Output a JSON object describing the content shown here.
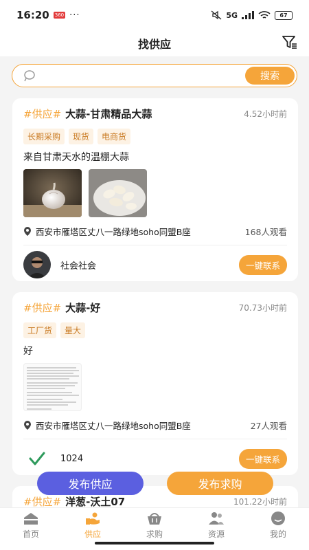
{
  "status": {
    "time": "16:20",
    "app_badge": "360",
    "dots": "···",
    "network": "5G",
    "battery": "67"
  },
  "header": {
    "title": "找供应"
  },
  "search": {
    "placeholder": "",
    "button": "搜索"
  },
  "listings": [
    {
      "hash_tag": "#供应#",
      "title": "大蒜-甘肃精品大蒜",
      "time": "4.52小时前",
      "labels": [
        "长期采购",
        "现货",
        "电商货"
      ],
      "description": "来自甘肃天水的温棚大蒜",
      "location": "西安市雁塔区丈八一路绿地soho同盟B座",
      "views": "168人观看",
      "user": "社会社会",
      "contact": "一键联系"
    },
    {
      "hash_tag": "#供应#",
      "title": "大蒜-好",
      "time": "70.73小时前",
      "labels": [
        "工厂货",
        "量大"
      ],
      "description": "好",
      "location": "西安市雁塔区丈八一路绿地soho同盟B座",
      "views": "27人观看",
      "user": "1024",
      "contact": "一键联系"
    },
    {
      "hash_tag": "#供应#",
      "title": "洋葱-沃土07",
      "time": "101.22小时前"
    }
  ],
  "actions": {
    "publish_supply": "发布供应",
    "publish_demand": "发布求购"
  },
  "tabs": [
    {
      "label": "首页",
      "icon": "home-icon"
    },
    {
      "label": "供应",
      "icon": "supply-icon"
    },
    {
      "label": "求购",
      "icon": "basket-icon"
    },
    {
      "label": "资源",
      "icon": "people-icon"
    },
    {
      "label": "我的",
      "icon": "profile-icon"
    }
  ],
  "colors": {
    "accent": "#f5a53a",
    "supply_button": "#5b5fe0"
  }
}
